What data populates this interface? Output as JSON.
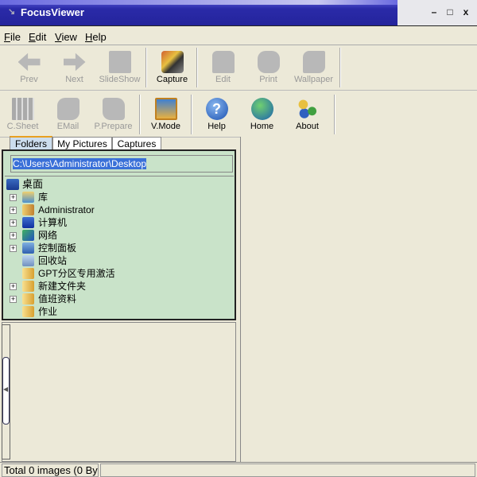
{
  "window": {
    "title": "FocusViewer",
    "minimize": "–",
    "maximize": "□",
    "close": "x"
  },
  "menu": [
    {
      "label": "File",
      "accel": "F",
      "rest": "ile"
    },
    {
      "label": "Edit",
      "accel": "E",
      "rest": "dit"
    },
    {
      "label": "View",
      "accel": "V",
      "rest": "iew"
    },
    {
      "label": "Help",
      "accel": "H",
      "rest": "elp"
    }
  ],
  "toolbar1": [
    {
      "label": "Prev",
      "enabled": false
    },
    {
      "label": "Next",
      "enabled": false
    },
    {
      "label": "SlideShow",
      "enabled": false
    },
    {
      "label": "Capture",
      "enabled": true
    },
    {
      "label": "Edit",
      "enabled": false
    },
    {
      "label": "Print",
      "enabled": false
    },
    {
      "label": "Wallpaper",
      "enabled": false
    }
  ],
  "toolbar2": [
    {
      "label": "C.Sheet",
      "enabled": false
    },
    {
      "label": "EMail",
      "enabled": false
    },
    {
      "label": "P.Prepare",
      "enabled": false
    },
    {
      "label": "V.Mode",
      "enabled": true
    },
    {
      "label": "Help",
      "enabled": true
    },
    {
      "label": "Home",
      "enabled": true
    },
    {
      "label": "About",
      "enabled": true
    }
  ],
  "tabs": [
    "Folders",
    "My Pictures",
    "Captures"
  ],
  "path": "C:\\Users\\Administrator\\Desktop",
  "tree": {
    "root": "桌面",
    "items": [
      {
        "label": "库",
        "expandable": true
      },
      {
        "label": "Administrator",
        "expandable": true
      },
      {
        "label": "计算机",
        "expandable": true
      },
      {
        "label": "网络",
        "expandable": true
      },
      {
        "label": "控制面板",
        "expandable": true
      },
      {
        "label": "回收站",
        "expandable": false
      },
      {
        "label": "GPT分区专用激活",
        "expandable": false
      },
      {
        "label": "新建文件夹",
        "expandable": true
      },
      {
        "label": "值班资料",
        "expandable": true
      },
      {
        "label": "作业",
        "expandable": false
      }
    ]
  },
  "status": {
    "text": "Total 0 images (0 By"
  }
}
